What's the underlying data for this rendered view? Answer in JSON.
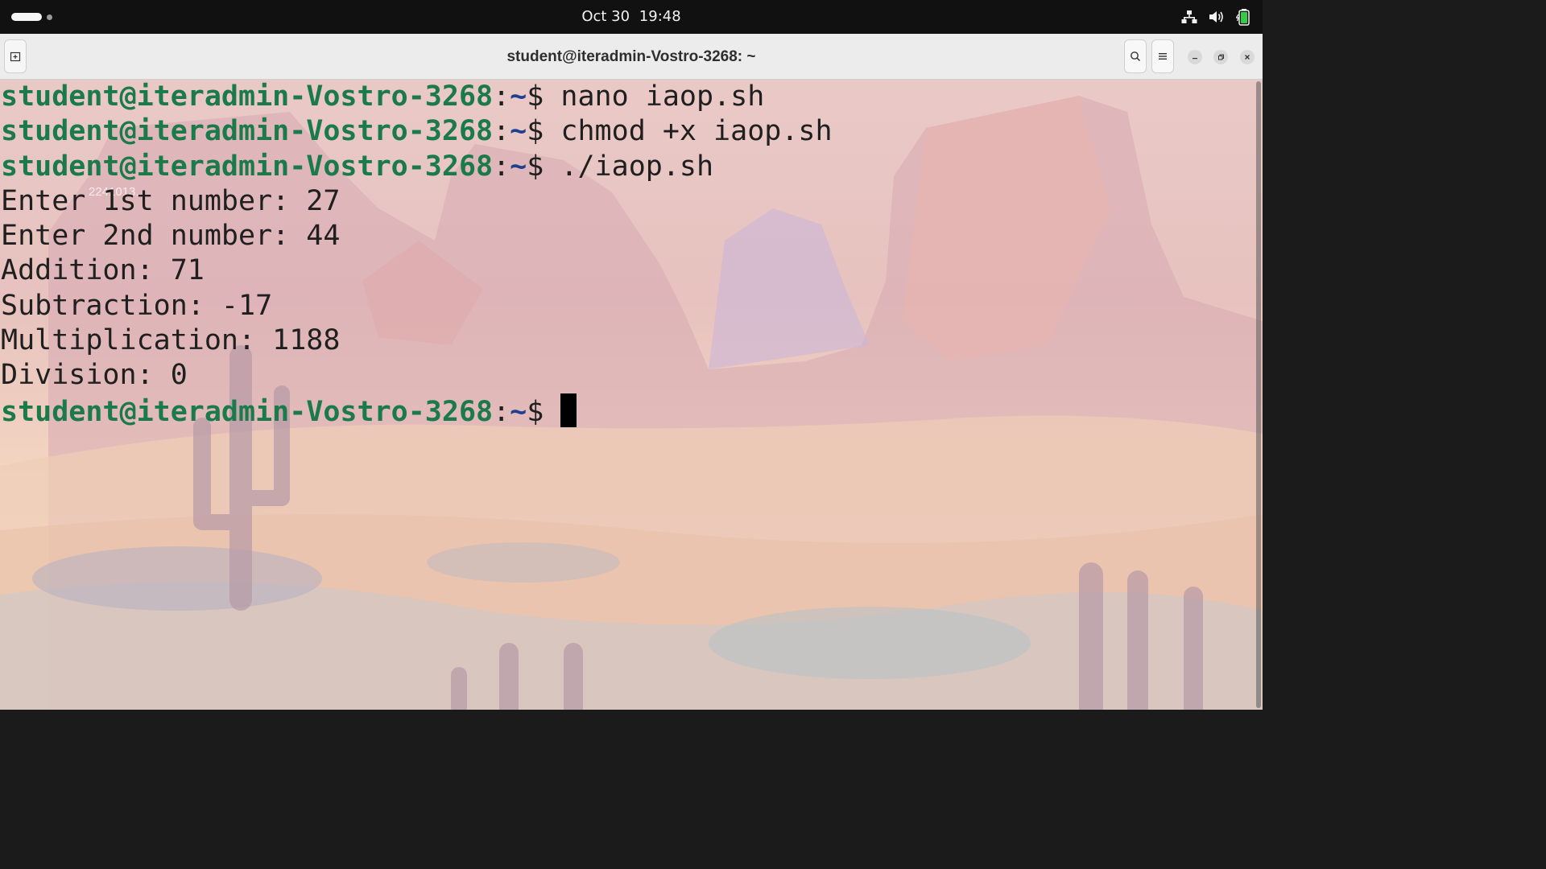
{
  "topbar": {
    "date": "Oct 30",
    "time": "19:48",
    "tray_icons": [
      "network-icon",
      "volume-icon",
      "battery-icon"
    ]
  },
  "window": {
    "title": "student@iteradmin-Vostro-3268: ~"
  },
  "desktop": {
    "icon_label": "2241013."
  },
  "terminal": {
    "prompt_user": "student@iteradmin-Vostro-3268",
    "prompt_sep": ":",
    "prompt_path": "~",
    "prompt_symbol": "$ ",
    "commands": [
      "nano iaop.sh",
      "chmod +x iaop.sh",
      "./iaop.sh"
    ],
    "output": [
      "Enter 1st number: 27",
      "Enter 2nd number: 44",
      "Addition: 71",
      "Subtraction: -17",
      "Multiplication: 1188",
      "Division: 0"
    ]
  },
  "colors": {
    "prompt_user": "#1a7a4a",
    "prompt_path": "#1f3f8f",
    "topbar_bg": "#111111",
    "header_bg": "#ececec"
  }
}
